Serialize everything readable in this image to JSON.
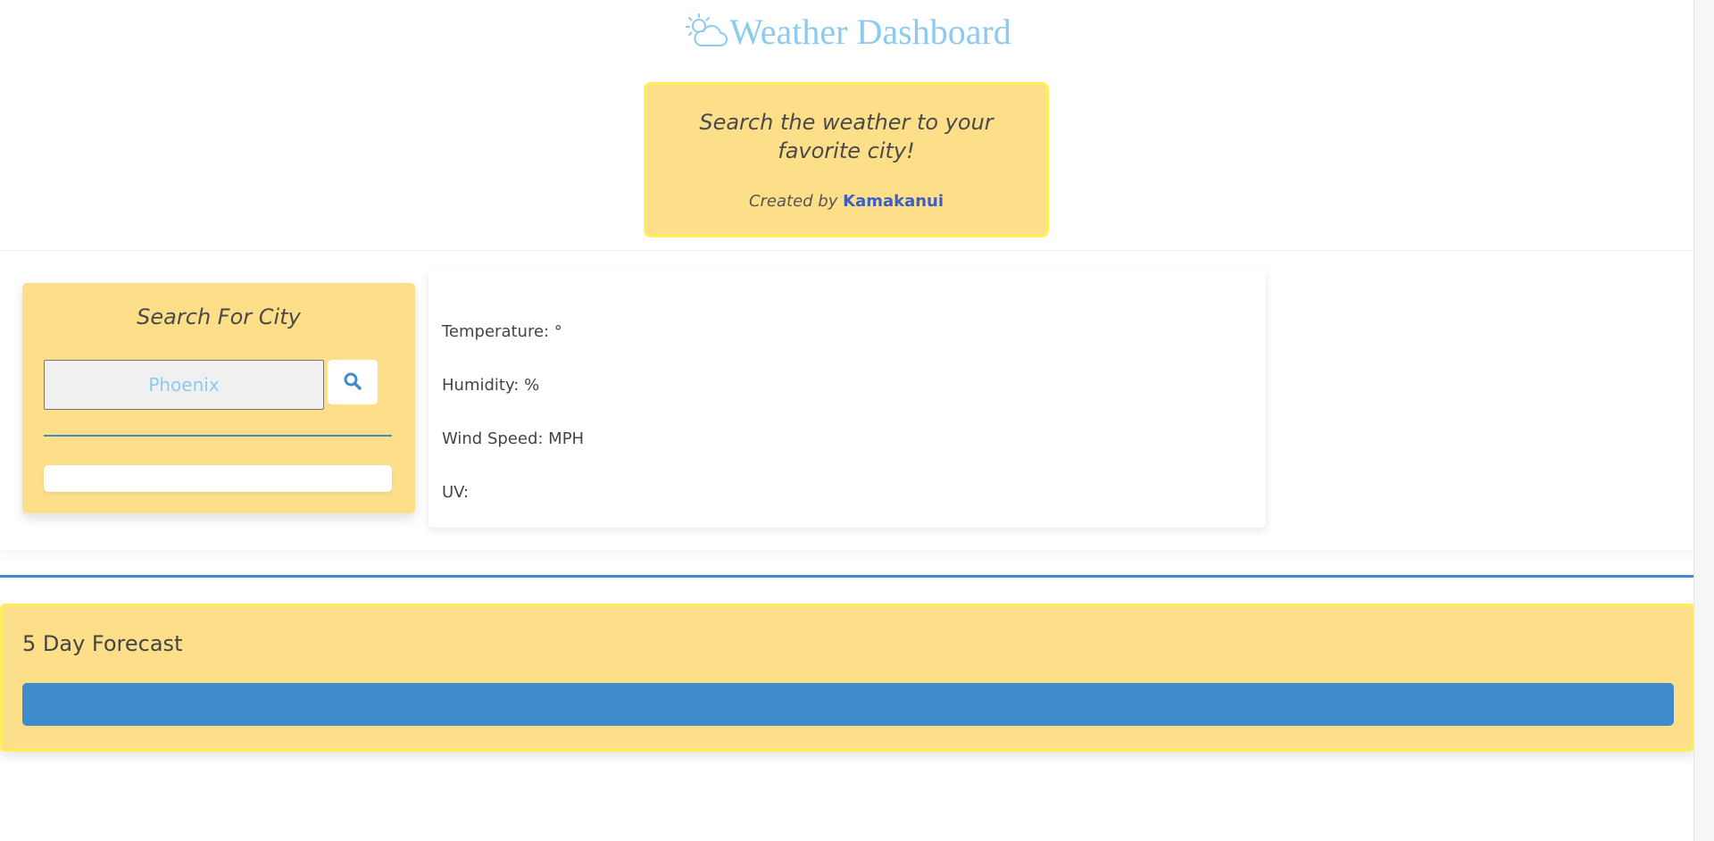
{
  "header": {
    "title": "Weather Dashboard",
    "icon": "cloud-sun-icon",
    "intro_text": "Search the weather to your favorite city!",
    "credit_prefix": "Created by",
    "credit_author": "Kamakanui"
  },
  "search": {
    "title": "Search For City",
    "input_placeholder": "Phoenix",
    "input_value": "",
    "button_icon": "search-icon"
  },
  "current_weather": {
    "city_line": "",
    "temperature_label": "Temperature: °",
    "humidity_label": "Humidity: %",
    "wind_label": "Wind Speed: MPH",
    "uv_label": "UV:"
  },
  "forecast": {
    "title": "5 Day Forecast"
  },
  "colors": {
    "card_yellow": "#fddf8a",
    "border_yellow": "#fdf05a",
    "accent_blue": "#3f8bcc",
    "title_blue": "#8ccaf0",
    "link_blue": "#3d5ec4"
  }
}
